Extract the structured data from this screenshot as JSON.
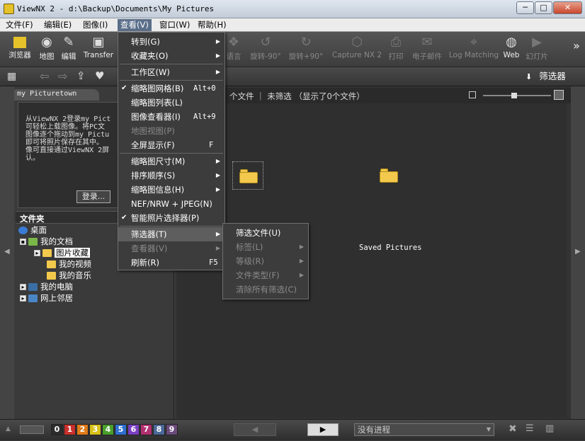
{
  "window": {
    "title": "ViewNX 2 - d:\\Backup\\Documents\\My Pictures",
    "min": "─",
    "max": "□",
    "close": "✕"
  },
  "menubar": [
    "文件(F)",
    "编辑(E)",
    "图像(I)",
    "查看(V)",
    "窗口(W)",
    "帮助(H)"
  ],
  "toolbar": {
    "items": [
      "浏览器",
      "地图",
      "编辑",
      "Transfer",
      "语言",
      "旋转-90°",
      "旋转+90°",
      "Capture NX 2",
      "打印",
      "电子邮件",
      "Log Matching",
      "Web",
      "幻灯片"
    ],
    "more": "»"
  },
  "filter_button": "筛选器",
  "left_tab": "my Picturetown",
  "promo_text": "从ViewNX 2登录my Pict\n可轻松上载图像。将PC文\n图像逐个拖动到my Pictu\n即可将照片保存在其中。\n像可直接通过ViewNX 2屏\n认。",
  "login": "登录...",
  "folders_title": "文件夹",
  "tree": [
    "桌面",
    "我的文档",
    "图片收藏",
    "我的视频",
    "我的音乐",
    "我的电脑",
    "网上邻居"
  ],
  "content_header": "个文件 ｜ 未筛选 （显示了0个文件）",
  "folder_label": "Saved Pictures",
  "view_menu": [
    {
      "label": "转到(G)",
      "sub": true
    },
    {
      "label": "收藏夹(O)",
      "sub": true
    },
    {
      "label": "工作区(W)",
      "sub": true
    },
    {
      "label": "缩略图网格(B)",
      "shortcut": "Alt+0",
      "check": true
    },
    {
      "label": "缩略图列表(L)"
    },
    {
      "label": "图像查看器(I)",
      "shortcut": "Alt+9"
    },
    {
      "label": "地图视图(P)",
      "disabled": true
    },
    {
      "label": "全屏显示(F)",
      "shortcut": "F"
    },
    {
      "label": "缩略图尺寸(M)",
      "sub": true
    },
    {
      "label": "排序顺序(S)",
      "sub": true
    },
    {
      "label": "缩略图信息(H)",
      "sub": true
    },
    {
      "label": "NEF/NRW + JPEG(N)"
    },
    {
      "label": "智能照片选择器(P)",
      "check": true
    },
    {
      "label": "筛选器(T)",
      "sub": true,
      "highlight": true
    },
    {
      "label": "查看器(V)",
      "sub": true,
      "disabled": true
    },
    {
      "label": "刷新(R)",
      "shortcut": "F5"
    }
  ],
  "filter_submenu": [
    {
      "label": "筛选文件(U)"
    },
    {
      "label": "标签(L)",
      "sub": true,
      "disabled": true
    },
    {
      "label": "等级(R)",
      "sub": true,
      "disabled": true
    },
    {
      "label": "文件类型(F)",
      "sub": true,
      "disabled": true
    },
    {
      "label": "清除所有筛选(C)",
      "disabled": true
    }
  ],
  "status": {
    "labels": [
      "0",
      "1",
      "2",
      "3",
      "4",
      "5",
      "6",
      "7",
      "8",
      "9"
    ],
    "label_colors": [
      "#2c2c2c",
      "#c9302c",
      "#e07b1a",
      "#d8c21a",
      "#4aa02c",
      "#2f6fd0",
      "#7a3fc0",
      "#b03070",
      "#4a6a9a",
      "#6a4a7a"
    ],
    "progress": "没有进程"
  }
}
